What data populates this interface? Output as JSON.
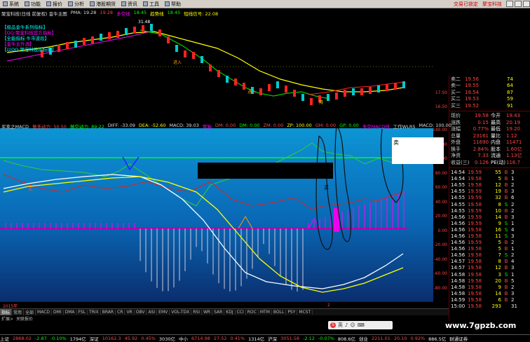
{
  "menu": [
    "系统",
    "功能",
    "报价",
    "分析",
    "港股期货",
    "资讯",
    "工具",
    "帮助"
  ],
  "status": [
    "交易已锁定",
    "聚宝科技"
  ],
  "price_header": [
    {
      "t": "聚宝科技(日线 前复权) 金牛主图",
      "c": "w"
    },
    {
      "t": "PMA: 19.28",
      "c": "w"
    },
    {
      "t": "19.28",
      "c": "r"
    },
    {
      "t": "多空线",
      "c": "m"
    },
    {
      "t": "18.45",
      "c": "g"
    },
    {
      "t": "趋势线",
      "c": "y"
    },
    {
      "t": "18.45",
      "c": "g"
    },
    {
      "t": "短线信号: 22.08",
      "c": "y"
    }
  ],
  "price_legend": [
    "【极品金牛系列指标】",
    "【QQ:聚宝科技官方指标】",
    "【全能指标 牛市波段】",
    "【金牛主升浪】",
    "【以QQ:聚宝科技指标组】"
  ],
  "signals": [
    "进入",
    "进入",
    "进入",
    "持",
    "31.48"
  ],
  "ind_header": [
    {
      "t": "买卖之MACD",
      "c": "w"
    },
    {
      "t": "做多动力: 50.50",
      "c": "r"
    },
    {
      "t": "做空动力: 89.22",
      "c": "g"
    },
    {
      "t": "DIFF: -33.09",
      "c": "w"
    },
    {
      "t": "DEA: -52.60",
      "c": "y"
    },
    {
      "t": "MACD: 39.03",
      "c": "w"
    },
    {
      "t": "零轴",
      "c": "m"
    },
    {
      "t": "DM: 0.00",
      "c": "r"
    },
    {
      "t": "DM: 0.00",
      "c": "g"
    },
    {
      "t": "ZM: 0.00",
      "c": "r"
    },
    {
      "t": "ZP: 100.00",
      "c": "y"
    },
    {
      "t": "GM: 0.00",
      "c": "r"
    },
    {
      "t": "GP: 0.00",
      "c": "g"
    },
    {
      "t": "多空MACD线",
      "c": "m"
    },
    {
      "t": "工作WLRS",
      "c": "w"
    },
    {
      "t": "MACD: 100.00",
      "c": "w"
    }
  ],
  "ind_labels": [
    "卖",
    "买",
    "买"
  ],
  "price_axis": [
    "17.50",
    "16.50"
  ],
  "ind_axis": [
    "140.00",
    "120.00",
    "100.00",
    "80.00",
    "60.00",
    "40.00",
    "20.00",
    "0.00",
    "-20.00",
    "-40.00",
    "-60.00",
    "-80.00"
  ],
  "quote_top": [
    {
      "l": "卖二",
      "p": "19.56",
      "v": "74"
    },
    {
      "l": "卖一",
      "p": "19.55",
      "v": "64"
    },
    {
      "l": "买一",
      "p": "19.54",
      "v": "87"
    },
    {
      "l": "买二",
      "p": "19.53",
      "v": "59"
    },
    {
      "l": "买三",
      "p": "19.52",
      "v": "91"
    }
  ],
  "quote_stats": [
    {
      "a": "现价",
      "b": "19.58",
      "c": "今开",
      "d": "19.43"
    },
    {
      "a": "涨跌",
      "b": "0.15",
      "c": "最高",
      "d": "20.19"
    },
    {
      "a": "涨幅",
      "b": "0.77%",
      "c": "最低",
      "d": "19.20"
    },
    {
      "a": "总量",
      "b": "23161",
      "c": "量比",
      "d": "1.12"
    },
    {
      "a": "外盘",
      "b": "11690",
      "c": "内盘",
      "d": "11471"
    },
    {
      "a": "换手",
      "b": "2.84%",
      "c": "股本",
      "d": "1.60亿"
    },
    {
      "a": "净资",
      "b": "7.33",
      "c": "流通",
      "d": "1.13亿"
    },
    {
      "a": "收益(三)",
      "b": "0.126",
      "c": "PE(动)",
      "d": "116.7"
    }
  ],
  "ticks": [
    {
      "t": "14:54",
      "p": "19.59",
      "v": "55",
      "s": "B",
      "n": "3"
    },
    {
      "t": "14:54",
      "p": "19.58",
      "v": "5",
      "s": "B",
      "n": "1"
    },
    {
      "t": "14:55",
      "p": "19.58",
      "v": "12",
      "s": "B",
      "n": "2"
    },
    {
      "t": "14:55",
      "p": "19.59",
      "v": "19",
      "s": "B",
      "n": "3"
    },
    {
      "t": "14:55",
      "p": "19.59",
      "v": "32",
      "s": "B",
      "n": "6"
    },
    {
      "t": "14:55",
      "p": "19.58",
      "v": "8",
      "s": "S",
      "n": "2"
    },
    {
      "t": "14:55",
      "p": "19.59",
      "v": "10",
      "s": "B",
      "n": "2"
    },
    {
      "t": "14:56",
      "p": "19.59",
      "v": "14",
      "s": "B",
      "n": "3"
    },
    {
      "t": "14:56",
      "p": "19.59",
      "v": "9",
      "s": "S",
      "n": "1"
    },
    {
      "t": "14:56",
      "p": "19.58",
      "v": "16",
      "s": "S",
      "n": "4"
    },
    {
      "t": "14:56",
      "p": "19.58",
      "v": "11",
      "s": "S",
      "n": "3"
    },
    {
      "t": "14:56",
      "p": "19.59",
      "v": "5",
      "s": "B",
      "n": "2"
    },
    {
      "t": "14:56",
      "p": "19.58",
      "v": "5",
      "s": "B",
      "n": "1"
    },
    {
      "t": "14:56",
      "p": "19.58",
      "v": "7",
      "s": "S",
      "n": "2"
    },
    {
      "t": "14:57",
      "p": "19.58",
      "v": "8",
      "s": "B",
      "n": "4"
    },
    {
      "t": "14:57",
      "p": "19.58",
      "v": "12",
      "s": "B",
      "n": "3"
    },
    {
      "t": "14:58",
      "p": "19.58",
      "v": "3",
      "s": "S",
      "n": "1"
    },
    {
      "t": "14:58",
      "p": "19.58",
      "v": "20",
      "s": "B",
      "n": "5"
    },
    {
      "t": "14:58",
      "p": "19.58",
      "v": "9",
      "s": "B",
      "n": "2"
    },
    {
      "t": "14:58",
      "p": "19.58",
      "v": "14",
      "s": "B",
      "n": "3"
    },
    {
      "t": "14:59",
      "p": "19.58",
      "v": "6",
      "s": "B",
      "n": "2"
    },
    {
      "t": "15:00",
      "p": "19.58",
      "v": "293",
      "s": "",
      "n": "31"
    }
  ],
  "scroll_label": "2015年",
  "scroll_mark": "2",
  "tabs": [
    "指标",
    "常用",
    "全部",
    "MACD",
    "DMI",
    "DMA",
    "FSL",
    "TRIX",
    "BRAR",
    "CR",
    "VR",
    "OBV",
    "ASI",
    "EMV",
    "VOL-TDX",
    "RSI",
    "WR",
    "SAR",
    "KDJ",
    "CCI",
    "ROC",
    "MTM",
    "BOLL",
    "PSY",
    "MCST"
  ],
  "tabs2": [
    "扩展>",
    "关联报价"
  ],
  "ticker": [
    {
      "t": "上证",
      "c": "w"
    },
    {
      "t": "2868.02",
      "c": "r"
    },
    {
      "t": "-2.87",
      "c": "g"
    },
    {
      "t": "-0.10%",
      "c": "g"
    },
    {
      "t": "1794亿",
      "c": "w"
    },
    {
      "t": "深证",
      "c": "w"
    },
    {
      "t": "10162.3",
      "c": "r"
    },
    {
      "t": "45.92",
      "c": "r"
    },
    {
      "t": "0.45%",
      "c": "r"
    },
    {
      "t": "3030亿",
      "c": "w"
    },
    {
      "t": "中小",
      "c": "w"
    },
    {
      "t": "6714.98",
      "c": "r"
    },
    {
      "t": "27.52",
      "c": "r"
    },
    {
      "t": "0.41%",
      "c": "r"
    },
    {
      "t": "1314亿",
      "c": "w"
    },
    {
      "t": "沪深",
      "c": "w"
    },
    {
      "t": "3051.58",
      "c": "r"
    },
    {
      "t": "-2.12",
      "c": "g"
    },
    {
      "t": "-0.07%",
      "c": "g"
    },
    {
      "t": "808.6亿",
      "c": "w"
    },
    {
      "t": "创业",
      "c": "w"
    },
    {
      "t": "2211.01",
      "c": "r"
    },
    {
      "t": "20.10",
      "c": "r"
    },
    {
      "t": "0.92%",
      "c": "r"
    },
    {
      "t": "886.5亿",
      "c": "w"
    },
    {
      "t": "财通证券",
      "c": "w"
    }
  ],
  "ime": [
    "S",
    "英",
    "♪",
    "☺",
    "⌨"
  ],
  "watermark": "www.7gpzb.com",
  "popup": "卖"
}
